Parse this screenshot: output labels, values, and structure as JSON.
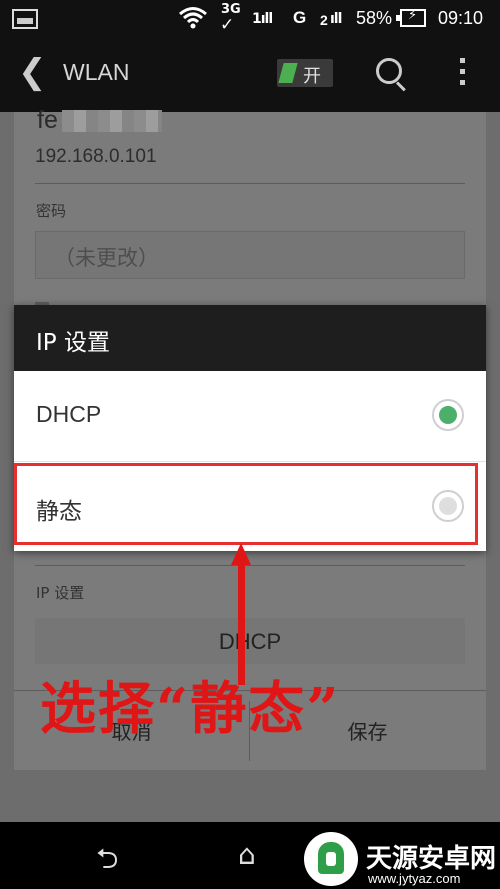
{
  "status_bar": {
    "network_3g": "3G",
    "signal_g": "G",
    "signal_2": "2",
    "battery_percent": "58%",
    "time": "09:10"
  },
  "top_bar": {
    "title": "WLAN",
    "toggle_label": "开",
    "icons": [
      "back-icon",
      "search-icon",
      "more-vert-icon"
    ]
  },
  "background": {
    "network_name": "fe",
    "ip_address": "192.168.0.101",
    "password_label": "密码",
    "password_placeholder": "（未更改）",
    "ip_settings_label": "IP 设置",
    "ip_settings_value": "DHCP",
    "cancel_label": "取消",
    "save_label": "保存"
  },
  "dialog": {
    "title": "IP 设置",
    "options": [
      {
        "label": "DHCP",
        "selected": true
      },
      {
        "label": "静态",
        "selected": false
      }
    ]
  },
  "annotation": {
    "text": "选择“静态”",
    "color": "#e01515"
  },
  "nav_bar": {
    "icons": [
      "back-nav-icon",
      "home-nav-icon"
    ]
  },
  "watermark": {
    "title": "天源安卓网",
    "url": "www.jytyaz.com"
  }
}
